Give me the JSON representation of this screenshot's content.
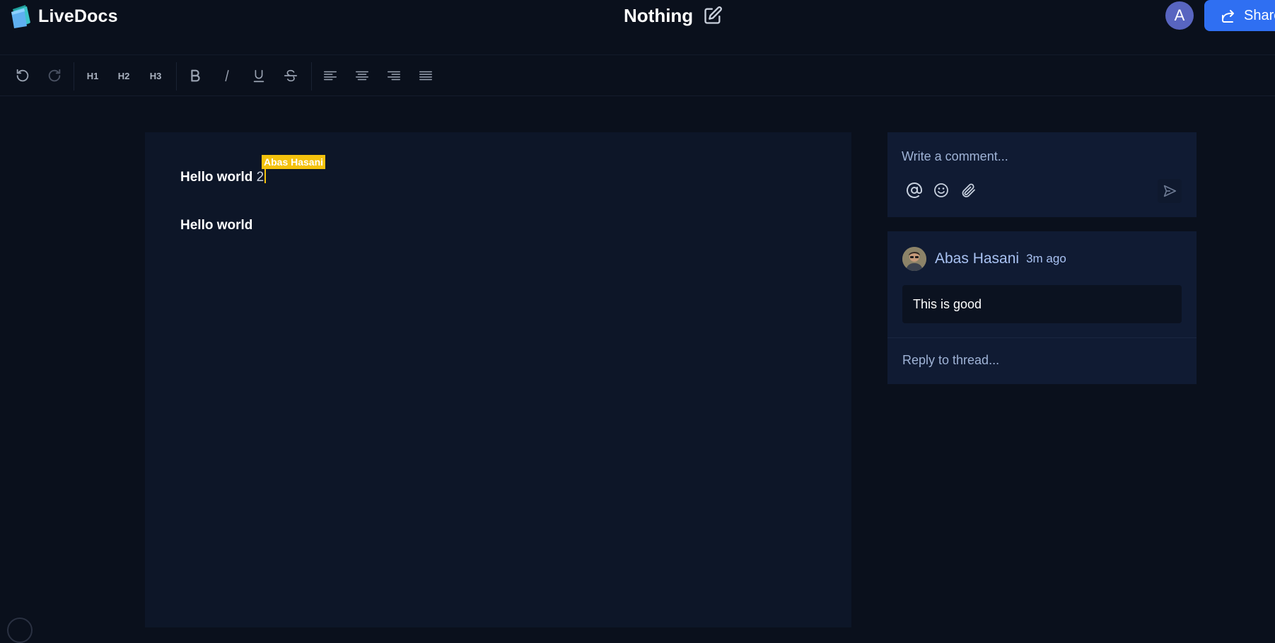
{
  "app": {
    "name": "LiveDocs",
    "document_title": "Nothing"
  },
  "header": {
    "avatar_initial": "A",
    "share_label": "Share"
  },
  "toolbar": {
    "headings": [
      "H1",
      "H2",
      "H3"
    ]
  },
  "editor": {
    "line1_bold": "Hello world",
    "line1_typed": " 2",
    "line2": "Hello world",
    "collaborator_cursor_label": "Abas Hasani",
    "cursor_color": "#f4c20d"
  },
  "comments": {
    "composer_placeholder": "Write a comment...",
    "thread": {
      "author": "Abas Hasani",
      "time": "3m ago",
      "body": "This is good",
      "reply_placeholder": "Reply to thread..."
    }
  },
  "colors": {
    "accent": "#2f6ff2",
    "background": "#0a101c",
    "panel": "#101b33"
  }
}
